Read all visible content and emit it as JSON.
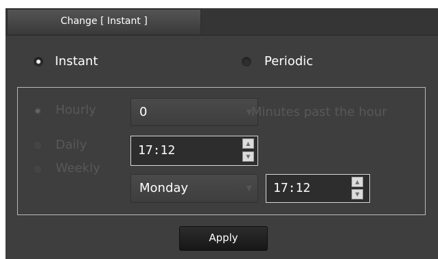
{
  "tab": {
    "label": "Change [ Instant ]"
  },
  "mode": {
    "instant_label": "Instant",
    "periodic_label": "Periodic",
    "selected": "Instant"
  },
  "schedule": {
    "hourly": {
      "label": "Hourly",
      "value": "0",
      "suffix": "Minutes past the hour"
    },
    "daily": {
      "label": "Daily",
      "time": "17:12"
    },
    "weekly": {
      "label": "Weekly",
      "day": "Monday",
      "time": "17:12"
    }
  },
  "apply_label": "Apply",
  "icons": {
    "spin_up": "spin-up-icon",
    "spin_down": "spin-down-icon",
    "dropdown": "chevron-down-icon"
  }
}
